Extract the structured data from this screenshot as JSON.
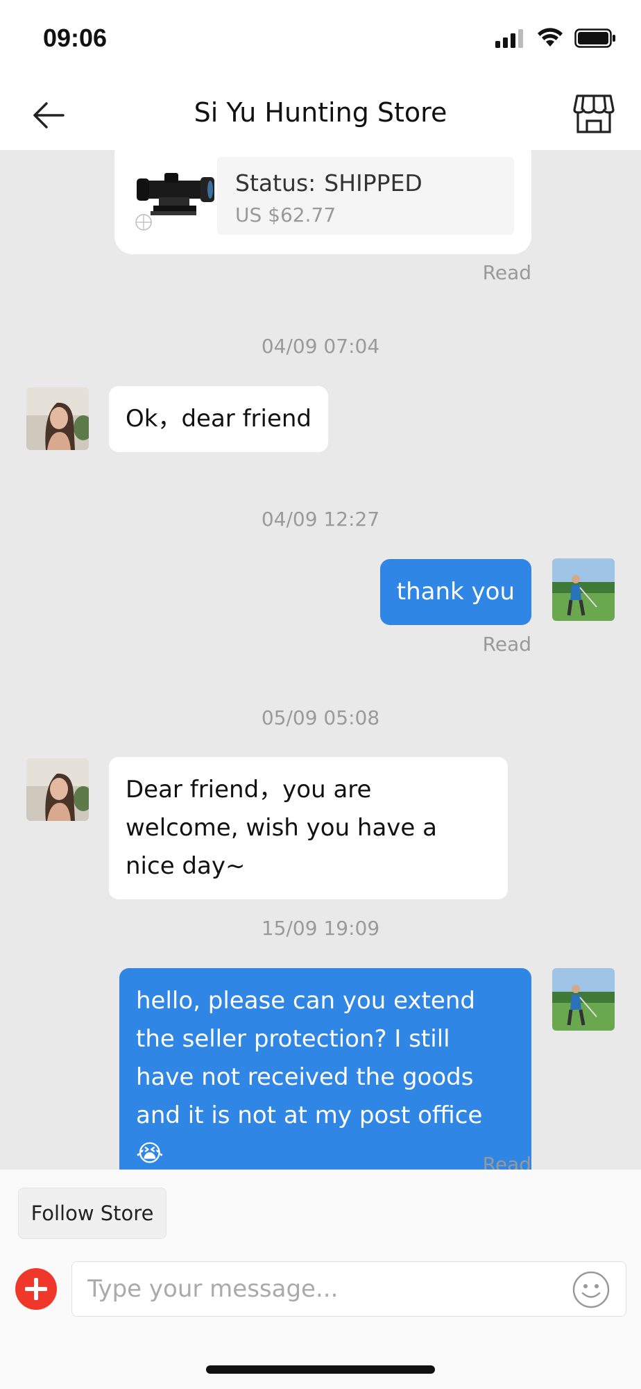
{
  "status_bar": {
    "time": "09:06"
  },
  "header": {
    "title": "Si Yu Hunting Store"
  },
  "order": {
    "status_label": "Status:",
    "status_value": "SHIPPED",
    "price": "US $62.77"
  },
  "messages": [
    {
      "type": "read",
      "text": "Read"
    },
    {
      "type": "timestamp",
      "text": "04/09 07:04"
    },
    {
      "type": "incoming",
      "text": "Ok，dear friend"
    },
    {
      "type": "timestamp",
      "text": "04/09 12:27"
    },
    {
      "type": "outgoing",
      "text": "thank you"
    },
    {
      "type": "read",
      "text": "Read"
    },
    {
      "type": "timestamp",
      "text": "05/09 05:08"
    },
    {
      "type": "incoming",
      "text": "Dear friend，you are welcome, wish you have a nice day~"
    },
    {
      "type": "timestamp",
      "text": "15/09 19:09"
    },
    {
      "type": "outgoing",
      "text": "hello, please can you extend the seller protection? I still have not received the goods and it is not at my post office 😭"
    },
    {
      "type": "read",
      "text": "Read"
    }
  ],
  "footer": {
    "follow_label": "Follow Store",
    "input_placeholder": "Type your message..."
  },
  "colors": {
    "outgoing_bubble": "#2f86e5",
    "incoming_bubble": "#ffffff",
    "chat_bg": "#e9e9e9",
    "plus_button": "#f0382a"
  }
}
